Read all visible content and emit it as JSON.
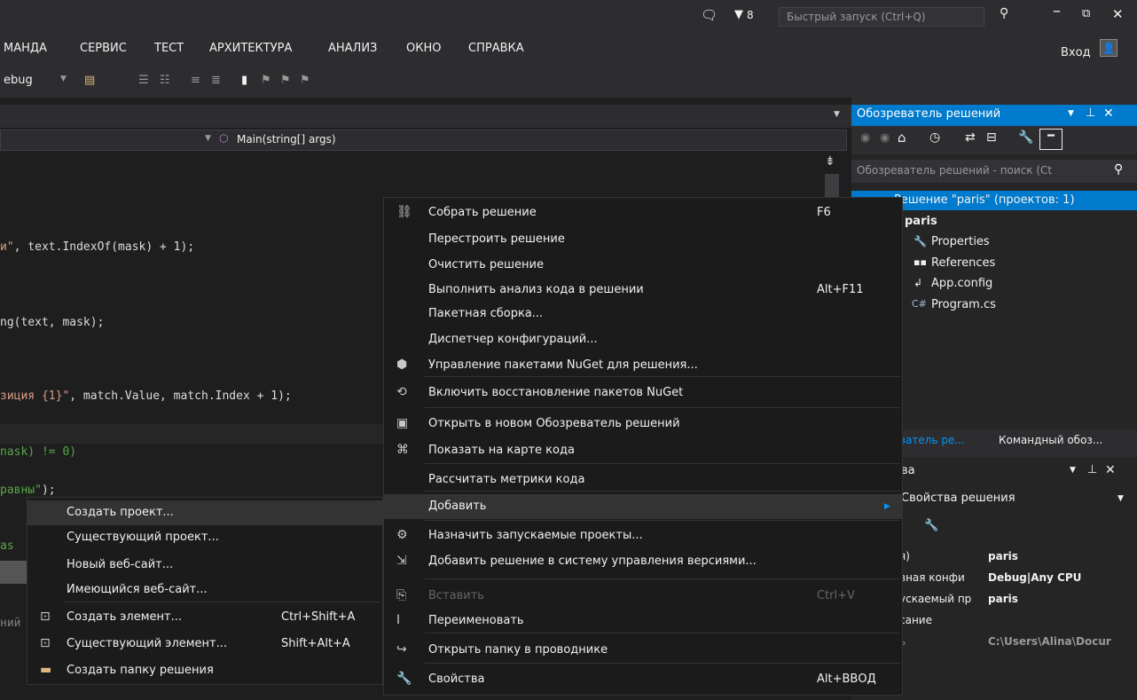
{
  "titlebar": {
    "notif_count": "8",
    "quick_launch_placeholder": "Быстрый запуск (Ctrl+Q)"
  },
  "menubar": {
    "items": [
      "МАНДА",
      "СЕРВИС",
      "ТЕСТ",
      "АРХИТЕКТУРА",
      "АНАЛИЗ",
      "ОКНО",
      "СПРАВКА"
    ],
    "login": "Вход"
  },
  "toolbar": {
    "config": "ebug"
  },
  "editor": {
    "method_nav": "Main(string[] args)",
    "lines": [
      {
        "a": "и\"",
        "b": ", text.IndexOf(mask) + 1);"
      },
      {
        "a": "",
        "b": "ng(text, mask);"
      },
      {
        "a": "зиция {1}\"",
        "b": ", match.Value, match.Index + 1);"
      },
      {
        "a": "",
        "b": "nask) != 0)"
      },
      {
        "a": "равны\"",
        "b": ");"
      },
      {
        "a": "",
        "b": "as"
      },
      {
        "a": "",
        "b": "ний"
      }
    ]
  },
  "solution_explorer": {
    "title": "Обозреватель решений",
    "search_placeholder": "Обозреватель решений - поиск (Ct",
    "solution_label": "Решение \"paris\" (проектов: 1)",
    "project": "paris",
    "items": [
      "Properties",
      "References",
      "App.config",
      "Program.cs"
    ],
    "tabs": [
      "ватель ре...",
      "Командный обоз..."
    ]
  },
  "properties": {
    "title": "ва",
    "subtitle": "Свойства решения",
    "rows": [
      {
        "k": "я)",
        "v": "paris"
      },
      {
        "k": "вная конфи",
        "v": "Debug|Any CPU"
      },
      {
        "k": "ускаемый пр",
        "v": "paris"
      },
      {
        "k": "сание",
        "v": ""
      },
      {
        "k": "ь",
        "v": "C:\\Users\\Alina\\Docur"
      }
    ]
  },
  "main_menu": {
    "items": [
      {
        "icon": "build-icon",
        "label": "Собрать решение",
        "shortcut": "F6"
      },
      {
        "label": "Перестроить решение",
        "shortcut": ""
      },
      {
        "label": "Очистить решение",
        "shortcut": ""
      },
      {
        "label": "Выполнить анализ кода в решении",
        "shortcut": "Alt+F11"
      },
      {
        "label": "Пакетная сборка...",
        "shortcut": ""
      },
      {
        "label": "Диспетчер конфигураций...",
        "shortcut": ""
      },
      {
        "icon": "nuget-icon",
        "label": "Управление пакетами NuGet для решения...",
        "shortcut": ""
      },
      {
        "icon": "restore-icon",
        "label": "Включить восстановление пакетов NuGet",
        "shortcut": ""
      },
      {
        "icon": "new-window-icon",
        "label": "Открыть в новом Обозреватель решений",
        "shortcut": ""
      },
      {
        "icon": "code-map-icon",
        "label": "Показать на карте кода",
        "shortcut": ""
      },
      {
        "label": "Рассчитать метрики кода",
        "shortcut": ""
      },
      {
        "label": "Добавить",
        "shortcut": ""
      },
      {
        "icon": "gear-icon",
        "label": "Назначить запускаемые проекты...",
        "shortcut": ""
      },
      {
        "icon": "vcs-icon",
        "label": "Добавить решение в систему управления версиями...",
        "shortcut": ""
      },
      {
        "icon": "paste-icon",
        "label": "Вставить",
        "shortcut": "Ctrl+V"
      },
      {
        "icon": "rename-icon",
        "label": "Переименовать",
        "shortcut": ""
      },
      {
        "icon": "open-folder-icon",
        "label": "Открыть папку в проводнике",
        "shortcut": ""
      },
      {
        "icon": "wrench-icon",
        "label": "Свойства",
        "shortcut": "Alt+ВВОД"
      }
    ]
  },
  "sub_menu": {
    "items": [
      {
        "label": "Создать проект...",
        "shortcut": ""
      },
      {
        "label": "Существующий проект...",
        "shortcut": ""
      },
      {
        "label": "Новый веб-сайт...",
        "shortcut": ""
      },
      {
        "label": "Имеющийся веб-сайт...",
        "shortcut": ""
      },
      {
        "label": "Создать элемент...",
        "shortcut": "Ctrl+Shift+A"
      },
      {
        "label": "Существующий элемент...",
        "shortcut": "Shift+Alt+A"
      },
      {
        "label": "Создать папку решения",
        "shortcut": ""
      }
    ]
  }
}
